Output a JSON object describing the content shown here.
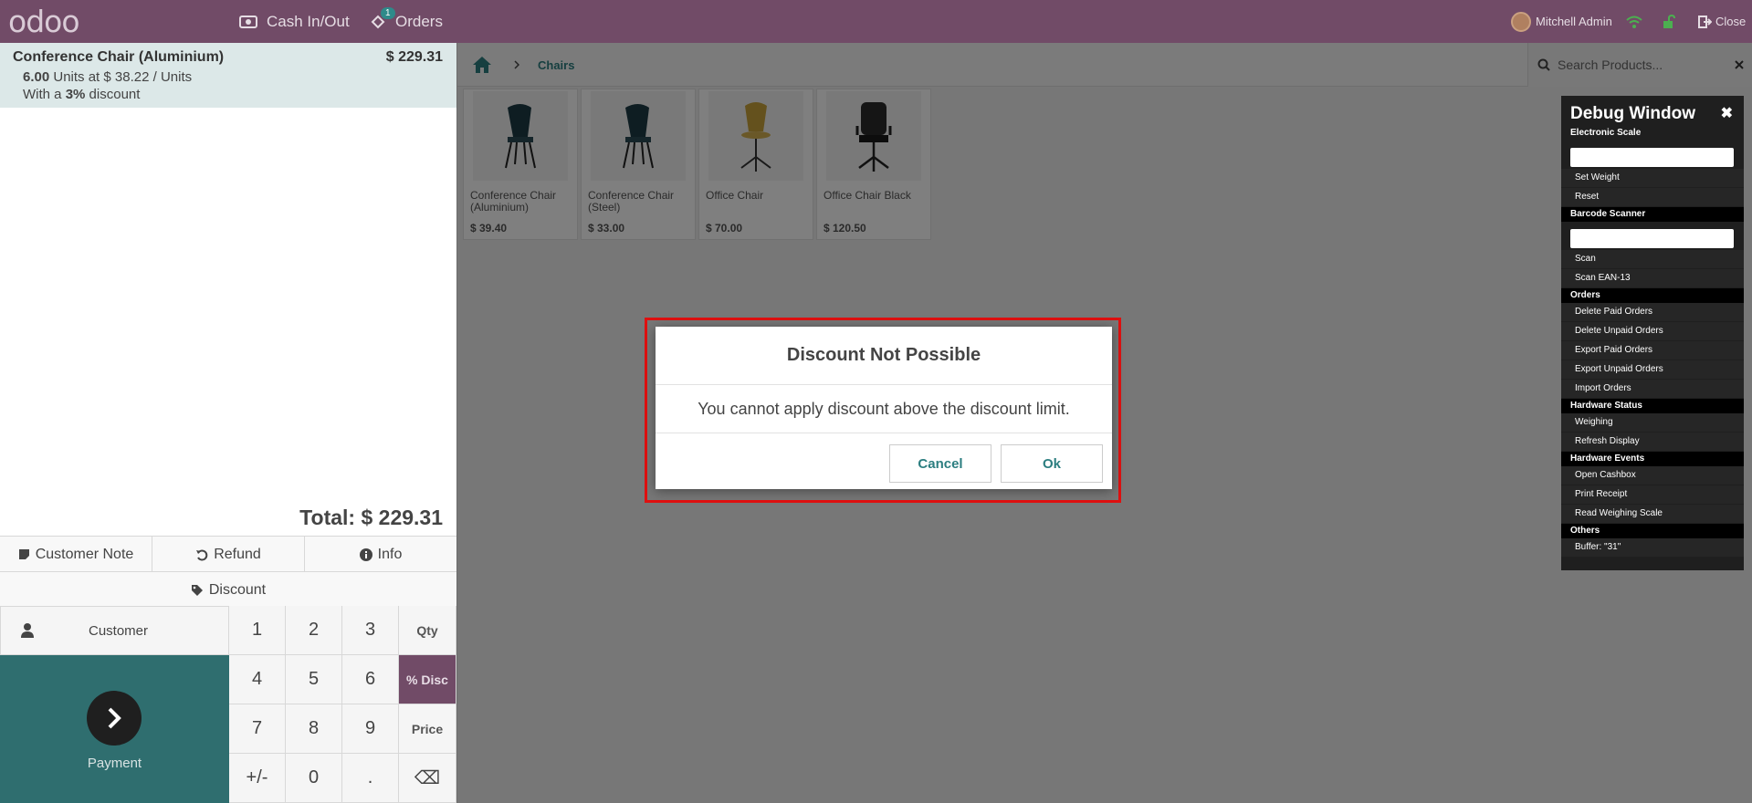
{
  "topbar": {
    "logo": "odoo",
    "cash_in_out": "Cash In/Out",
    "orders": "Orders",
    "orders_count": "1",
    "user": "Mitchell Admin",
    "close": "Close"
  },
  "order": {
    "line": {
      "product": "Conference Chair (Aluminium)",
      "price": "$ 229.31",
      "qty": "6.00",
      "unit_text": "Units at $ 38.22 / Units",
      "discount_prefix": "With a",
      "discount_value": "3%",
      "discount_suffix": "discount"
    },
    "total_label": "Total:",
    "total_value": "$ 229.31"
  },
  "controls": {
    "customer_note": "Customer Note",
    "refund": "Refund",
    "info": "Info",
    "discount": "Discount",
    "customer": "Customer",
    "payment": "Payment"
  },
  "numpad": {
    "keys": [
      "1",
      "2",
      "3",
      "Qty",
      "4",
      "5",
      "6",
      "% Disc",
      "7",
      "8",
      "9",
      "Price",
      "+/-",
      "0",
      ".",
      "⌫"
    ],
    "active_mode": "% Disc"
  },
  "breadcrumb": {
    "category": "Chairs"
  },
  "search": {
    "placeholder": "Search Products..."
  },
  "products": [
    {
      "name": "Conference Chair (Aluminium)",
      "price": "$ 39.40"
    },
    {
      "name": "Conference Chair (Steel)",
      "price": "$ 33.00"
    },
    {
      "name": "Office Chair",
      "price": "$ 70.00"
    },
    {
      "name": "Office Chair Black",
      "price": "$ 120.50"
    }
  ],
  "debug": {
    "title": "Debug Window",
    "sections": {
      "scale": "Electronic Scale",
      "barcode": "Barcode Scanner",
      "orders": "Orders",
      "hw_status": "Hardware Status",
      "hw_events": "Hardware Events",
      "others": "Others"
    },
    "items": {
      "set_weight": "Set Weight",
      "reset": "Reset",
      "scan": "Scan",
      "scan_ean": "Scan EAN-13",
      "delete_paid": "Delete Paid Orders",
      "delete_unpaid": "Delete Unpaid Orders",
      "export_paid": "Export Paid Orders",
      "export_unpaid": "Export Unpaid Orders",
      "import_orders": "Import Orders",
      "weighing": "Weighing",
      "refresh_display": "Refresh Display",
      "open_cashbox": "Open Cashbox",
      "print_receipt": "Print Receipt",
      "read_scale": "Read Weighing Scale",
      "buffer": "Buffer: \"31\""
    }
  },
  "dialog": {
    "title": "Discount Not Possible",
    "body": "You cannot apply discount above the discount limit.",
    "cancel": "Cancel",
    "ok": "Ok"
  },
  "colors": {
    "brand": "#714b67",
    "accent": "#2c7e80",
    "highlight_frame": "#e01010"
  }
}
